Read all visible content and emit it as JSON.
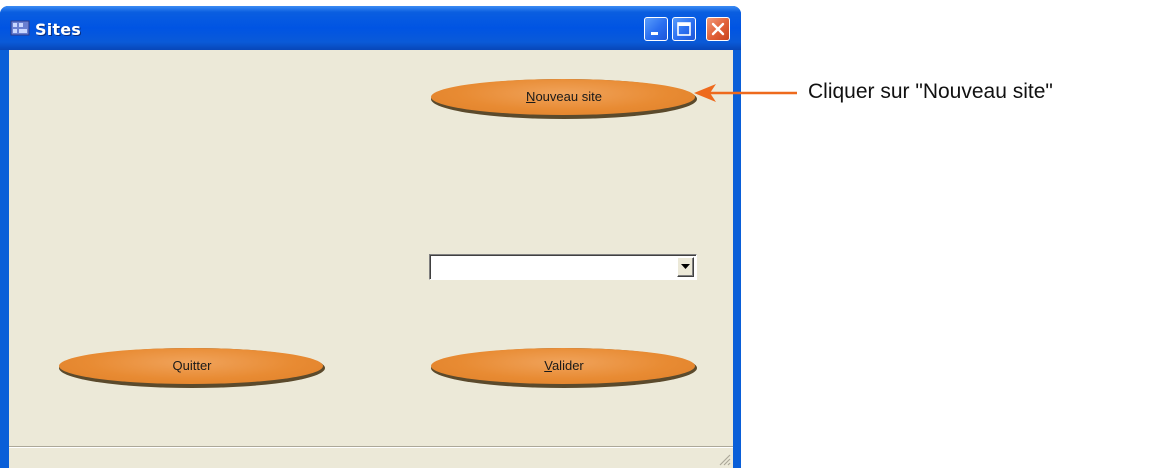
{
  "window": {
    "title": "Sites",
    "controls": {
      "minimize_icon": "minimize-icon",
      "maximize_icon": "maximize-icon",
      "close_icon": "close-icon"
    }
  },
  "buttons": {
    "new_site": {
      "label_mnemonic": "N",
      "label_rest": "ouveau site"
    },
    "quit": {
      "label": "Quitter"
    },
    "validate": {
      "label_mnemonic": "V",
      "label_rest": "alider"
    }
  },
  "site_select": {
    "value": ""
  },
  "annotation": {
    "text": "Cliquer sur \"Nouveau site\"",
    "color": "#ee6a1d"
  },
  "colors": {
    "titlebar": "#0054e3",
    "client_bg": "#ece9d8",
    "button_face": "#e88b33",
    "close_button": "#e06037"
  }
}
